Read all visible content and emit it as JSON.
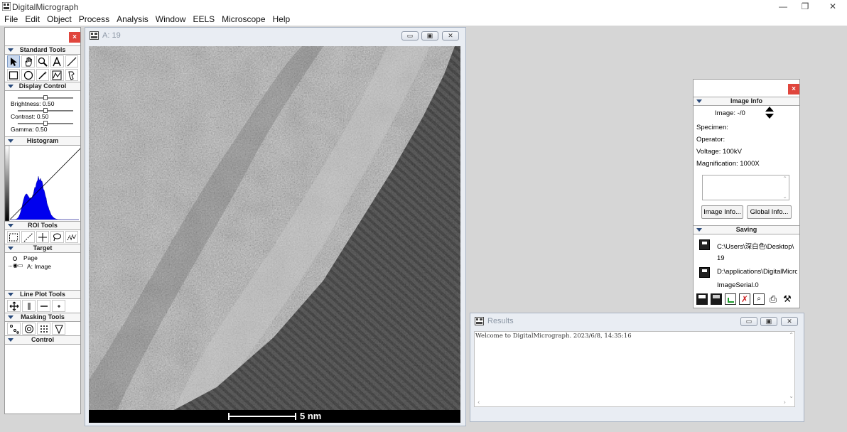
{
  "app": {
    "title": "DigitalMicrograph",
    "window_controls": [
      "—",
      "❐",
      "✕"
    ]
  },
  "menu": [
    "File",
    "Edit",
    "Object",
    "Process",
    "Analysis",
    "Window",
    "EELS",
    "Microscope",
    "Help"
  ],
  "left_panel": {
    "close": "×",
    "sections": {
      "standard_tools": "Standard Tools",
      "display_control": "Display Control",
      "histogram": "Histogram",
      "roi_tools": "ROI Tools",
      "target": "Target",
      "line_plot_tools": "Line Plot Tools",
      "masking_tools": "Masking Tools",
      "control": "Control"
    },
    "display_control": {
      "brightness": "Brightness: 0.50",
      "contrast": "Contrast: 0.50",
      "gamma": "Gamma: 0.50",
      "levels": [
        0.5,
        0.5,
        0.5
      ]
    },
    "target": {
      "page": "Page",
      "image": "A: Image"
    }
  },
  "image_window": {
    "title": "A: 19",
    "buttons": [
      "▭",
      "▣",
      "✕"
    ],
    "scale_label": "5 nm"
  },
  "results_window": {
    "title": "Results",
    "text": "Welcome to DigitalMicrograph.  2023/6/8, 14:35:16"
  },
  "info_panel": {
    "close": "×",
    "image_info_header": "Image Info",
    "image_label": "Image: -/0",
    "specimen": "Specimen:",
    "operator": "Operator:",
    "voltage": "Voltage: 100kV",
    "magnification": "Magnification: 1000X",
    "buttons": {
      "image_info": "Image Info...",
      "global_info": "Global Info..."
    },
    "saving_header": "Saving",
    "save_path_1": "C:\\Users\\深白色\\Desktop\\",
    "save_name_1": "19",
    "save_path_2": "D:\\applications\\DigitalMicrog",
    "save_name_2": "ImageSerial.0"
  },
  "colors": {
    "histogram_fill": "#0000ee",
    "close_button": "#e0463d",
    "panel_header_arrow": "#2a4a7a"
  }
}
